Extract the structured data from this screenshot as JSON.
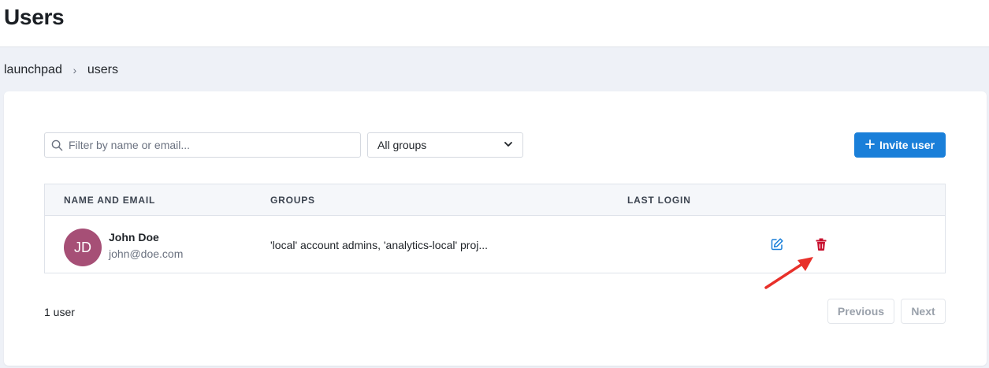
{
  "header": {
    "title": "Users"
  },
  "breadcrumb": {
    "items": [
      "launchpad",
      "users"
    ],
    "separator": "›"
  },
  "filters": {
    "search_placeholder": "Filter by name or email...",
    "group_select_value": "All groups",
    "invite_label": "Invite user"
  },
  "table": {
    "columns": [
      "NAME AND EMAIL",
      "GROUPS",
      "LAST LOGIN"
    ],
    "rows": [
      {
        "initials": "JD",
        "name": "John Doe",
        "email": "john@doe.com",
        "groups": "'local' account admins, 'analytics-local' proj...",
        "last_login": "",
        "avatar_color": "#a64f76"
      }
    ]
  },
  "footer": {
    "count": "1 user",
    "previous": "Previous",
    "next": "Next"
  },
  "colors": {
    "primary": "#1a7fd9",
    "danger": "#c8102e",
    "annotation": "#e8302a"
  },
  "icons": [
    "search-icon",
    "chevron-down-icon",
    "plus-icon",
    "edit-icon",
    "trash-icon",
    "annotation-arrow"
  ]
}
